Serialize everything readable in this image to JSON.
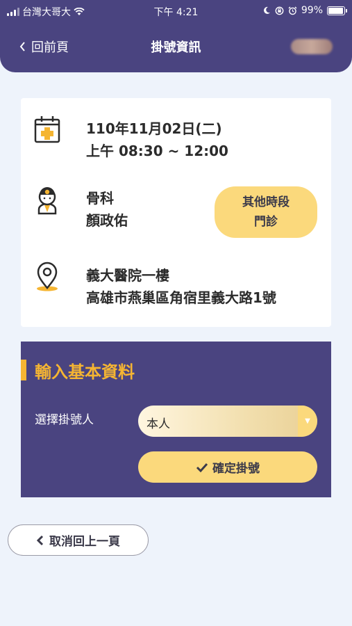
{
  "status_bar": {
    "carrier": "台灣大哥大",
    "time": "下午 4:21",
    "battery": "99%"
  },
  "nav": {
    "back_label": "回前頁",
    "title": "掛號資訊"
  },
  "appointment": {
    "date": "110年11月02日(二)",
    "session": "上午 08:30 ~ 12:00",
    "department": "骨科",
    "doctor": "顏政佑",
    "location_name": "義大醫院一樓",
    "address": "高雄市燕巢區角宿里義大路1號",
    "other_sessions_line1": "其他時段",
    "other_sessions_line2": "門診"
  },
  "form": {
    "title": "輸入基本資料",
    "registrant_label": "選擇掛號人",
    "registrant_value": "本人",
    "confirm_label": "確定掛號"
  },
  "cancel_label": "取消回上一頁",
  "colors": {
    "primary": "#4a4480",
    "accent": "#fbd97c",
    "title_accent": "#f5b532",
    "background": "#eef3fb"
  }
}
